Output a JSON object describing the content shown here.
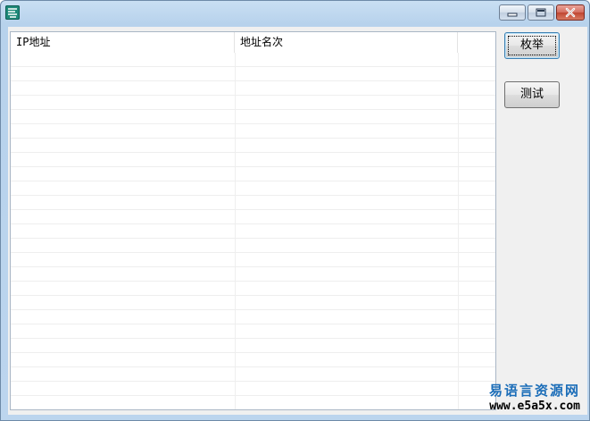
{
  "window": {
    "title": ""
  },
  "columns": [
    {
      "label": "IP地址"
    },
    {
      "label": "地址名次"
    },
    {
      "label": ""
    }
  ],
  "rows": [],
  "buttons": {
    "enumerate_label": "枚举",
    "test_label": "测试"
  },
  "watermark": {
    "line1": "易语言资源网",
    "line2": "www.e5a5x.com"
  }
}
